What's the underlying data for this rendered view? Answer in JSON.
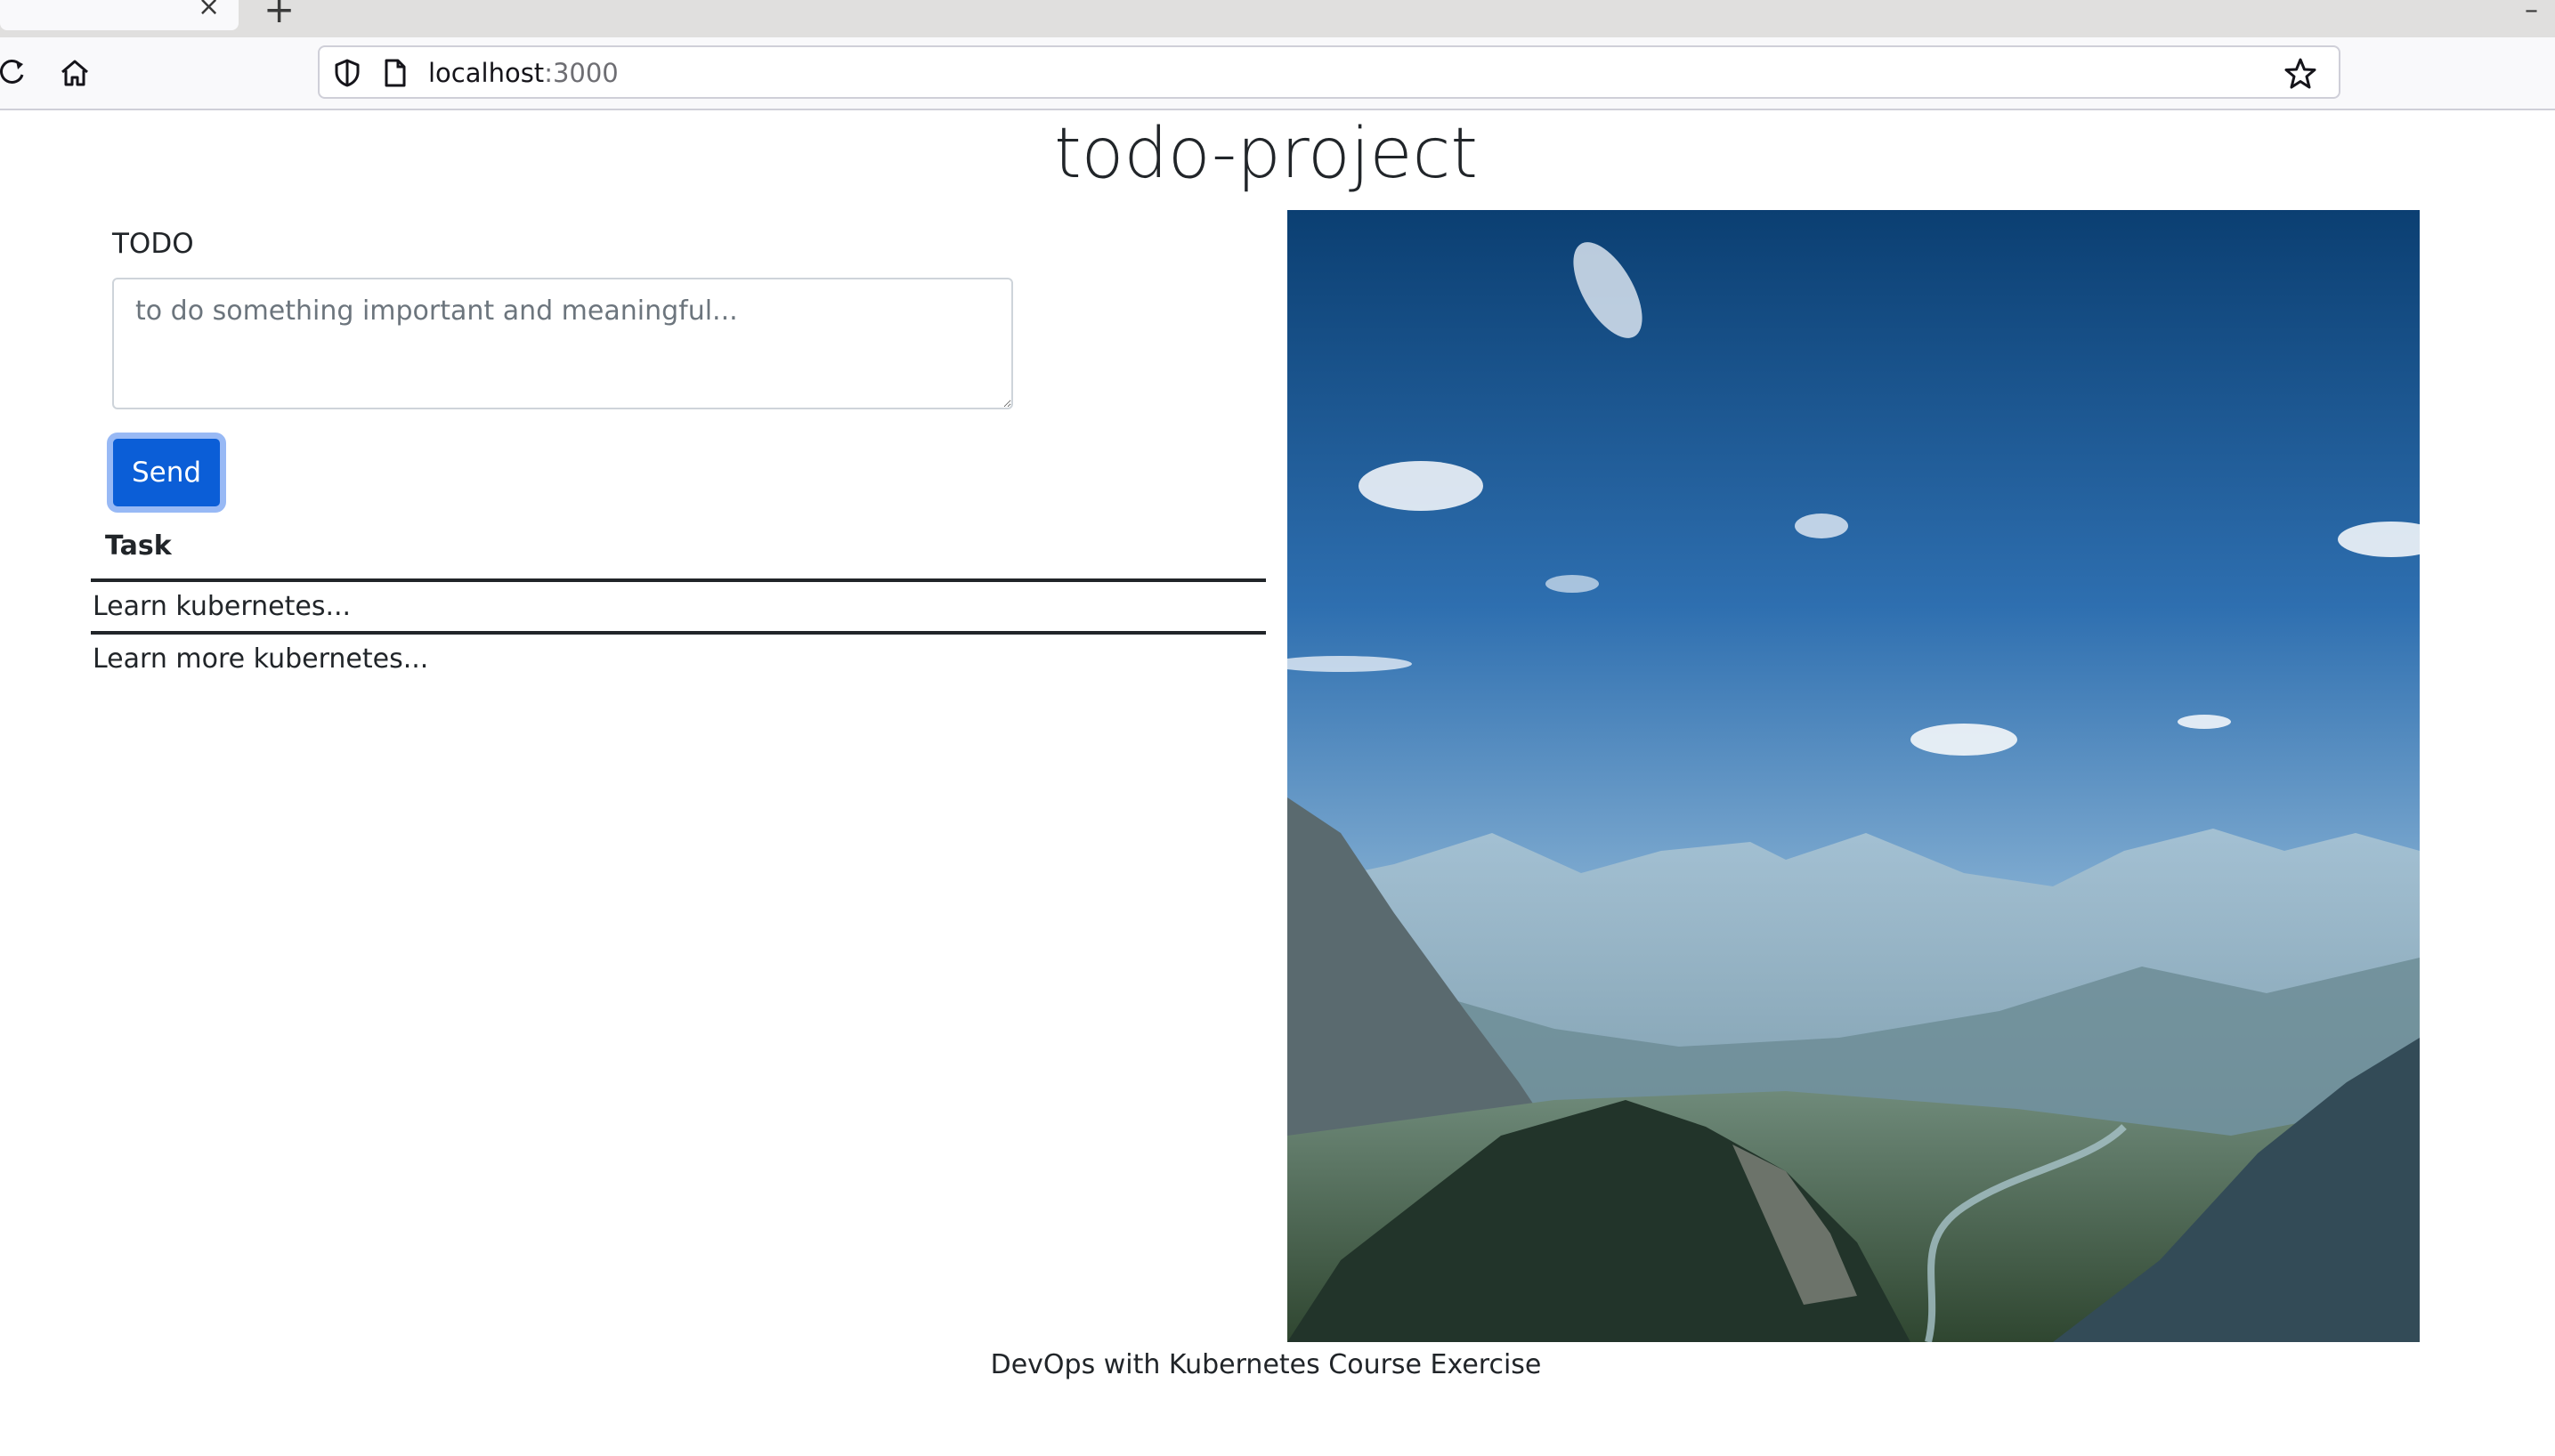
{
  "browser": {
    "tab": {
      "close_symbol": "×"
    },
    "new_tab_symbol": "+",
    "window_control_symbol": "–",
    "address": {
      "host": "localhost",
      "port": ":3000"
    },
    "icons": [
      "reload-icon",
      "home-icon",
      "shield-icon",
      "page-icon",
      "bookmark-star-icon"
    ]
  },
  "page": {
    "title": "todo-project",
    "form": {
      "label": "TODO",
      "placeholder": "to do something important and meaningful...",
      "send_label": "Send"
    },
    "table": {
      "header": "Task",
      "rows": [
        "Learn kubernetes...",
        "Learn more kubernetes..."
      ]
    },
    "image": {
      "subject": "mountain-valley-landscape"
    },
    "footer": "DevOps with Kubernetes Course Exercise"
  },
  "colors": {
    "primary_button": "#0b5ed7",
    "button_focus_ring": "#98b9f5",
    "text": "#212529",
    "sky_top": "#0f4f8c",
    "sky_bottom": "#bcd3e3"
  }
}
